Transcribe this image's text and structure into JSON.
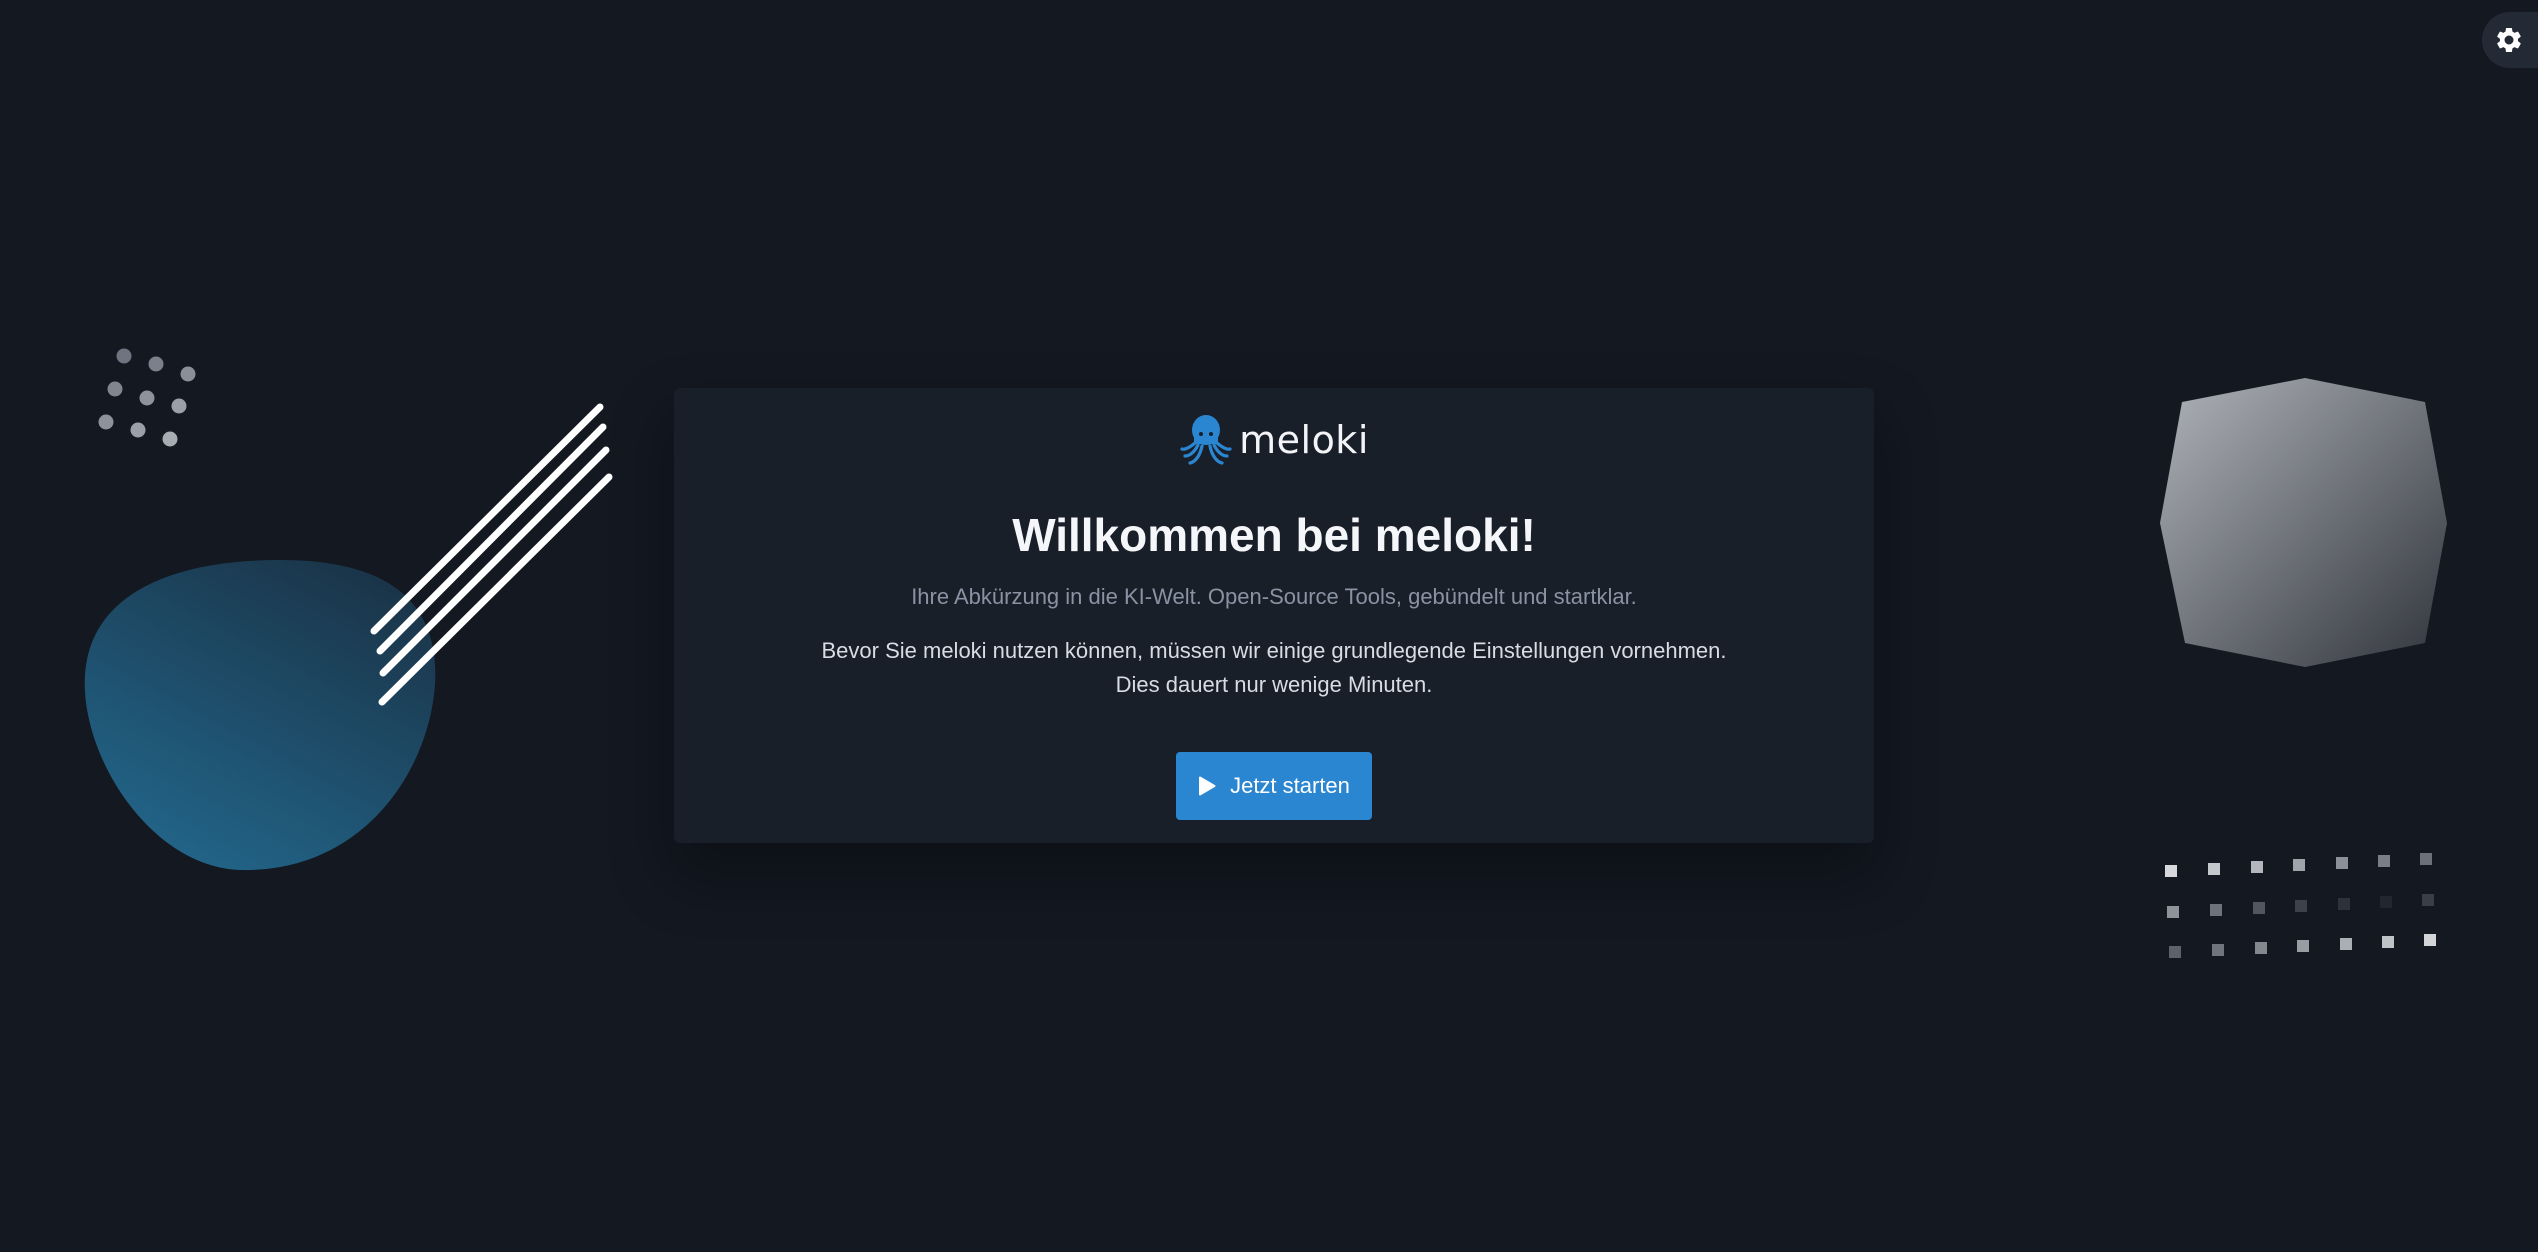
{
  "header": {
    "settings_icon": "gear-icon"
  },
  "brand": {
    "logo_icon": "octopus-icon",
    "name": "meloki",
    "logo_color": "#2b86d1"
  },
  "welcome": {
    "title": "Willkommen bei meloki!",
    "subtitle": "Ihre Abkürzung in die KI-Welt. Open-Source Tools, gebündelt und startklar.",
    "description_line1": "Bevor Sie meloki nutzen können, müssen wir einige grundlegende Einstellungen vornehmen.",
    "description_line2": "Dies dauert nur wenige Minuten."
  },
  "actions": {
    "start_label": "Jetzt starten",
    "start_icon": "play-icon",
    "accent_color": "#2b86d1"
  },
  "colors": {
    "background": "#131821",
    "card": "#191f29"
  }
}
